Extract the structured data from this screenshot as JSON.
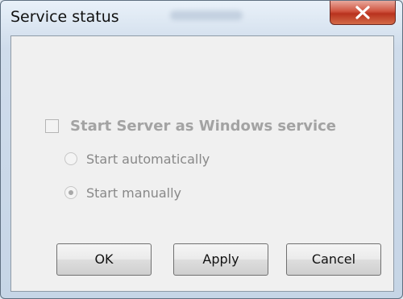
{
  "window": {
    "title": "Service status",
    "close_icon": "close-icon"
  },
  "service": {
    "checkbox_label": "Start Server as Windows service",
    "checkbox_checked": false,
    "options": [
      {
        "label": "Start automatically",
        "selected": false
      },
      {
        "label": "Start manually",
        "selected": true
      }
    ],
    "enabled": false
  },
  "buttons": {
    "ok_label": "OK",
    "apply_label": "Apply",
    "cancel_label": "Cancel"
  },
  "colors": {
    "close_button": "#c7422d",
    "disabled_text": "#a3a3a3"
  }
}
